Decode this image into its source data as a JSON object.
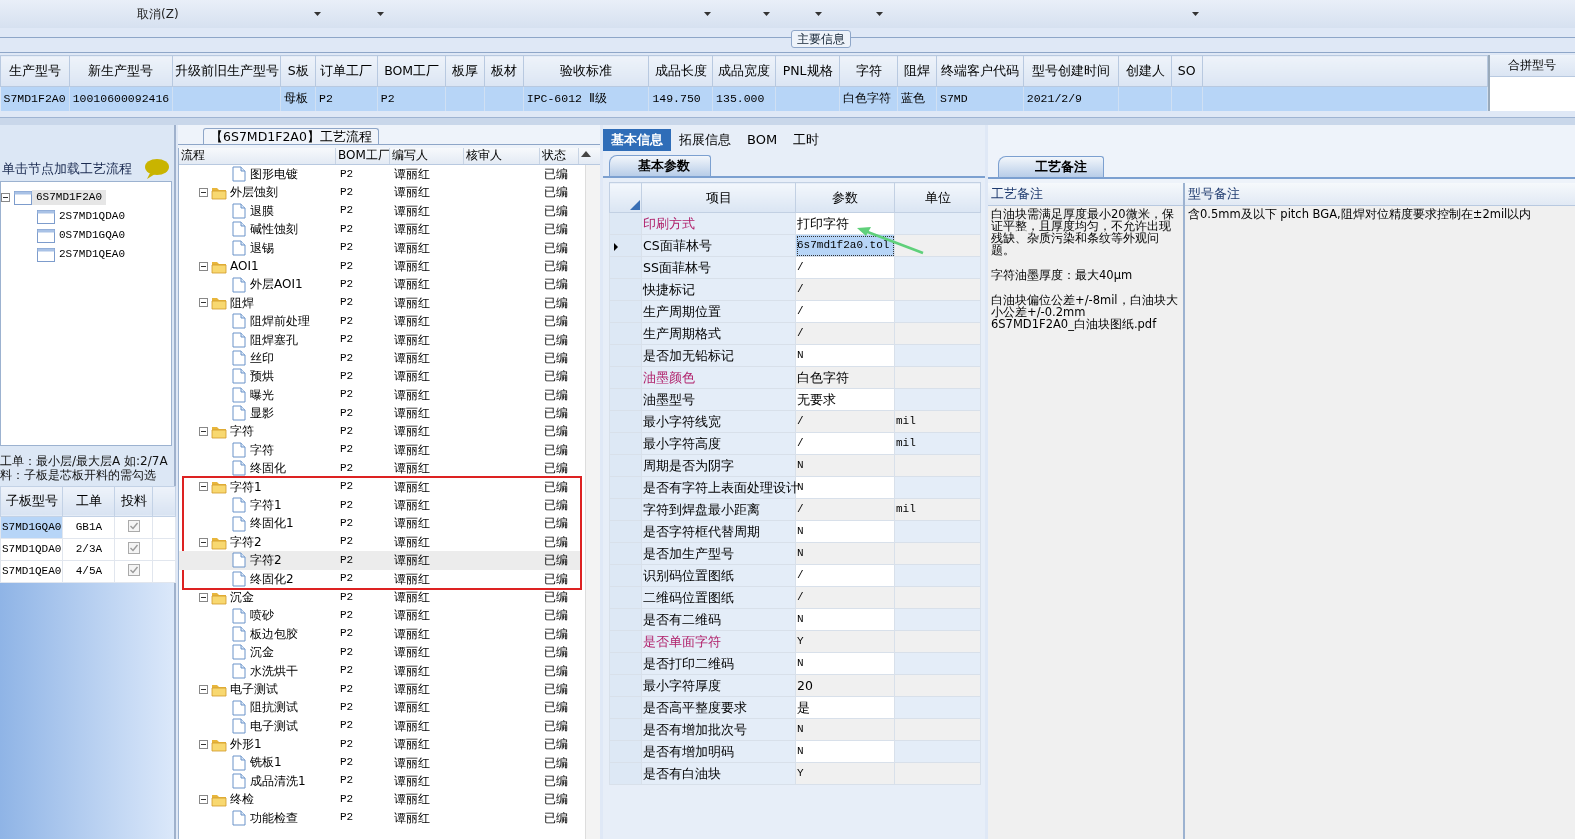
{
  "toolbar": {
    "cancel_label": "取消(Z)"
  },
  "main_info": {
    "title": "主要信息",
    "columns": [
      {
        "label": "生产型号",
        "value": "S7MD1F2A0"
      },
      {
        "label": "新生产型号",
        "value": "10010600092416"
      },
      {
        "label": "升级前旧生产型号"
      },
      {
        "label": "S板",
        "value": "母板"
      },
      {
        "label": "订单工厂",
        "value": "P2"
      },
      {
        "label": "BOM工厂",
        "value": "P2"
      },
      {
        "label": "板厚"
      },
      {
        "label": "板材"
      },
      {
        "label": "验收标准",
        "value": "IPC-6012 Ⅱ级"
      },
      {
        "label": "成品长度",
        "value": "149.750"
      },
      {
        "label": "成品宽度",
        "value": "135.000"
      },
      {
        "label": "PNL规格"
      },
      {
        "label": "字符",
        "value": "白色字符"
      },
      {
        "label": "阻焊",
        "value": "蓝色"
      },
      {
        "label": "终端客户代码",
        "value": "S7MD"
      },
      {
        "label": "型号创建时间",
        "value": "2021/2/9"
      },
      {
        "label": "创建人"
      },
      {
        "label": "SO"
      }
    ],
    "merge_column": "合拼型号"
  },
  "left_panel": {
    "hint": "单击节点加载工艺流程",
    "tree": [
      {
        "label": "6S7MD1F2A0",
        "selected": true,
        "expanded": true,
        "children": [
          {
            "label": "2S7MD1QDA0",
            "selected": false
          },
          {
            "label": "0S7MD1GQA0",
            "selected": false
          },
          {
            "label": "2S7MD1QEA0",
            "selected": false
          }
        ]
      }
    ],
    "notes": [
      "工单：最小层/最大层A 如:2/7A",
      "料：子板是芯板开料的需勾选"
    ],
    "child_table": {
      "columns": [
        "子板型号",
        "工单",
        "投料"
      ],
      "rows": [
        {
          "model": "S7MD1GQA0",
          "order": "GB1A",
          "checked": true,
          "selected": true
        },
        {
          "model": "S7MD1QDA0",
          "order": "2/3A",
          "checked": true,
          "selected": false
        },
        {
          "model": "S7MD1QEA0",
          "order": "4/5A",
          "checked": true,
          "selected": false
        }
      ]
    }
  },
  "process_flow": {
    "title": "【6S7MD1F2A0】工艺流程",
    "columns": [
      "流程",
      "BOM工厂",
      "编写人",
      "核审人",
      "状态"
    ],
    "rows": [
      {
        "kind": "file",
        "label": "图形电镀",
        "bom_factory": "P2",
        "author": "谭丽红",
        "status": "已编",
        "selected": false
      },
      {
        "kind": "folder",
        "label": "外层蚀刻",
        "bom_factory": "P2",
        "author": "谭丽红",
        "status": "已编",
        "selected": false,
        "expanded": true,
        "children": [
          {
            "kind": "file",
            "label": "退膜",
            "bom_factory": "P2",
            "author": "谭丽红",
            "status": "已编",
            "selected": false
          },
          {
            "kind": "file",
            "label": "碱性蚀刻",
            "bom_factory": "P2",
            "author": "谭丽红",
            "status": "已编",
            "selected": false
          },
          {
            "kind": "file",
            "label": "退锡",
            "bom_factory": "P2",
            "author": "谭丽红",
            "status": "已编",
            "selected": false
          }
        ]
      },
      {
        "kind": "folder",
        "label": "AOI1",
        "bom_factory": "P2",
        "author": "谭丽红",
        "status": "已编",
        "selected": false,
        "expanded": true,
        "children": [
          {
            "kind": "file",
            "label": "外层AOI1",
            "bom_factory": "P2",
            "author": "谭丽红",
            "status": "已编",
            "selected": false
          }
        ]
      },
      {
        "kind": "folder",
        "label": "阻焊",
        "bom_factory": "P2",
        "author": "谭丽红",
        "status": "已编",
        "selected": false,
        "expanded": true,
        "children": [
          {
            "kind": "file",
            "label": "阻焊前处理",
            "bom_factory": "P2",
            "author": "谭丽红",
            "status": "已编",
            "selected": false
          },
          {
            "kind": "file",
            "label": "阻焊塞孔",
            "bom_factory": "P2",
            "author": "谭丽红",
            "status": "已编",
            "selected": false
          },
          {
            "kind": "file",
            "label": "丝印",
            "bom_factory": "P2",
            "author": "谭丽红",
            "status": "已编",
            "selected": false
          },
          {
            "kind": "file",
            "label": "预烘",
            "bom_factory": "P2",
            "author": "谭丽红",
            "status": "已编",
            "selected": false
          },
          {
            "kind": "file",
            "label": "曝光",
            "bom_factory": "P2",
            "author": "谭丽红",
            "status": "已编",
            "selected": false
          },
          {
            "kind": "file",
            "label": "显影",
            "bom_factory": "P2",
            "author": "谭丽红",
            "status": "已编",
            "selected": false
          }
        ]
      },
      {
        "kind": "folder",
        "label": "字符",
        "bom_factory": "P2",
        "author": "谭丽红",
        "status": "已编",
        "selected": false,
        "expanded": true,
        "children": [
          {
            "kind": "file",
            "label": "字符",
            "bom_factory": "P2",
            "author": "谭丽红",
            "status": "已编",
            "selected": false
          },
          {
            "kind": "file",
            "label": "终固化",
            "bom_factory": "P2",
            "author": "谭丽红",
            "status": "已编",
            "selected": false
          }
        ]
      },
      {
        "kind": "folder",
        "label": "字符1",
        "bom_factory": "P2",
        "author": "谭丽红",
        "status": "已编",
        "selected": false,
        "highlighted": true,
        "expanded": true,
        "children": [
          {
            "kind": "file",
            "label": "字符1",
            "bom_factory": "P2",
            "author": "谭丽红",
            "status": "已编",
            "selected": false
          },
          {
            "kind": "file",
            "label": "终固化1",
            "bom_factory": "P2",
            "author": "谭丽红",
            "status": "已编",
            "selected": false
          }
        ]
      },
      {
        "kind": "folder",
        "label": "字符2",
        "bom_factory": "P2",
        "author": "谭丽红",
        "status": "已编",
        "selected": false,
        "highlighted": true,
        "expanded": true,
        "children": [
          {
            "kind": "file",
            "label": "字符2",
            "bom_factory": "P2",
            "author": "谭丽红",
            "status": "已编",
            "selected": true
          },
          {
            "kind": "file",
            "label": "终固化2",
            "bom_factory": "P2",
            "author": "谭丽红",
            "status": "已编",
            "selected": false
          }
        ]
      },
      {
        "kind": "folder",
        "label": "沉金",
        "bom_factory": "P2",
        "author": "谭丽红",
        "status": "已编",
        "selected": false,
        "expanded": true,
        "children": [
          {
            "kind": "file",
            "label": "喷砂",
            "bom_factory": "P2",
            "author": "谭丽红",
            "status": "已编",
            "selected": false
          },
          {
            "kind": "file",
            "label": "板边包胶",
            "bom_factory": "P2",
            "author": "谭丽红",
            "status": "已编",
            "selected": false
          },
          {
            "kind": "file",
            "label": "沉金",
            "bom_factory": "P2",
            "author": "谭丽红",
            "status": "已编",
            "selected": false
          },
          {
            "kind": "file",
            "label": "水洗烘干",
            "bom_factory": "P2",
            "author": "谭丽红",
            "status": "已编",
            "selected": false
          }
        ]
      },
      {
        "kind": "folder",
        "label": "电子测试",
        "bom_factory": "P2",
        "author": "谭丽红",
        "status": "已编",
        "selected": false,
        "expanded": true,
        "children": [
          {
            "kind": "file",
            "label": "阻抗测试",
            "bom_factory": "P2",
            "author": "谭丽红",
            "status": "已编",
            "selected": false
          },
          {
            "kind": "file",
            "label": "电子测试",
            "bom_factory": "P2",
            "author": "谭丽红",
            "status": "已编",
            "selected": false
          }
        ]
      },
      {
        "kind": "folder",
        "label": "外形1",
        "bom_factory": "P2",
        "author": "谭丽红",
        "status": "已编",
        "selected": false,
        "expanded": true,
        "children": [
          {
            "kind": "file",
            "label": "铣板1",
            "bom_factory": "P2",
            "author": "谭丽红",
            "status": "已编",
            "selected": false
          },
          {
            "kind": "file",
            "label": "成品清洗1",
            "bom_factory": "P2",
            "author": "谭丽红",
            "status": "已编",
            "selected": false
          }
        ]
      },
      {
        "kind": "folder",
        "label": "终检",
        "bom_factory": "P2",
        "author": "谭丽红",
        "status": "已编",
        "selected": false,
        "expanded": true,
        "children": [
          {
            "kind": "file",
            "label": "功能检查",
            "bom_factory": "P2",
            "author": "谭丽红",
            "status": "已编",
            "selected": false
          }
        ]
      }
    ]
  },
  "detail": {
    "tabs": [
      {
        "label": "基本信息",
        "selected": true
      },
      {
        "label": "拓展信息",
        "selected": false
      },
      {
        "label": "BOM",
        "selected": false
      },
      {
        "label": "工时",
        "selected": false
      }
    ],
    "subtab": "基本参数",
    "columns": [
      "项目",
      "参数",
      "单位"
    ],
    "rows": [
      {
        "item": "印刷方式",
        "value": "打印字符",
        "flagged": true,
        "current": false
      },
      {
        "item": "CS面菲林号",
        "value": "6s7md1f2a0.tol",
        "flagged": false,
        "current": true
      },
      {
        "item": "SS面菲林号",
        "value": "/",
        "flagged": false,
        "current": false
      },
      {
        "item": "快捷标记",
        "value": "/",
        "flagged": false,
        "current": false
      },
      {
        "item": "生产周期位置",
        "value": "/",
        "flagged": false,
        "current": false
      },
      {
        "item": "生产周期格式",
        "value": "/",
        "flagged": false,
        "current": false
      },
      {
        "item": "是否加无铅标记",
        "value": "N",
        "flagged": false,
        "current": false
      },
      {
        "item": "油墨颜色",
        "value": "白色字符",
        "flagged": true,
        "current": false
      },
      {
        "item": "油墨型号",
        "value": "无要求",
        "flagged": false,
        "current": false
      },
      {
        "item": "最小字符线宽",
        "value": "/",
        "unit": "mil",
        "flagged": false,
        "current": false
      },
      {
        "item": "最小字符高度",
        "value": "/",
        "unit": "mil",
        "flagged": false,
        "current": false
      },
      {
        "item": "周期是否为阴字",
        "value": "N",
        "flagged": false,
        "current": false
      },
      {
        "item": "是否有字符上表面处理设计",
        "value": "N",
        "flagged": false,
        "current": false
      },
      {
        "item": "字符到焊盘最小距离",
        "value": "/",
        "unit": "mil",
        "flagged": false,
        "current": false
      },
      {
        "item": "是否字符框代替周期",
        "value": "N",
        "flagged": false,
        "current": false
      },
      {
        "item": "是否加生产型号",
        "value": "N",
        "flagged": false,
        "current": false
      },
      {
        "item": "识别码位置图纸",
        "value": "/",
        "flagged": false,
        "current": false
      },
      {
        "item": "二维码位置图纸",
        "value": "/",
        "flagged": false,
        "current": false
      },
      {
        "item": "是否有二维码",
        "value": "N",
        "flagged": false,
        "current": false
      },
      {
        "item": "是否单面字符",
        "value": "Y",
        "flagged": true,
        "current": false
      },
      {
        "item": "是否打印二维码",
        "value": "N",
        "flagged": false,
        "current": false
      },
      {
        "item": "最小字符厚度",
        "value": "20",
        "flagged": false,
        "current": false
      },
      {
        "item": "是否高平整度要求",
        "value": "是",
        "flagged": false,
        "current": false
      },
      {
        "item": "是否有增加批次号",
        "value": "N",
        "flagged": false,
        "current": false
      },
      {
        "item": "是否有增加明码",
        "value": "N",
        "flagged": false,
        "current": false
      },
      {
        "item": "是否有白油块",
        "value": "Y",
        "flagged": false,
        "current": false
      }
    ]
  },
  "notes_panel": {
    "tab": "工艺备注",
    "process_notes": {
      "title": "工艺备注",
      "paragraphs": [
        "白油块需满足厚度最小20微米，保证平整，且厚度均匀，不允许出现残缺、杂质污染和条纹等外观问题。",
        "字符油墨厚度：最大40μm",
        "白油块偏位公差+/-8mil，白油块大小公差+/-0.2mm\n6S7MD1F2A0_白油块图纸.pdf"
      ]
    },
    "model_notes": {
      "title": "型号备注",
      "text": "含0.5mm及以下 pitch BGA,阻焊对位精度要求控制在±2mil以内"
    }
  }
}
